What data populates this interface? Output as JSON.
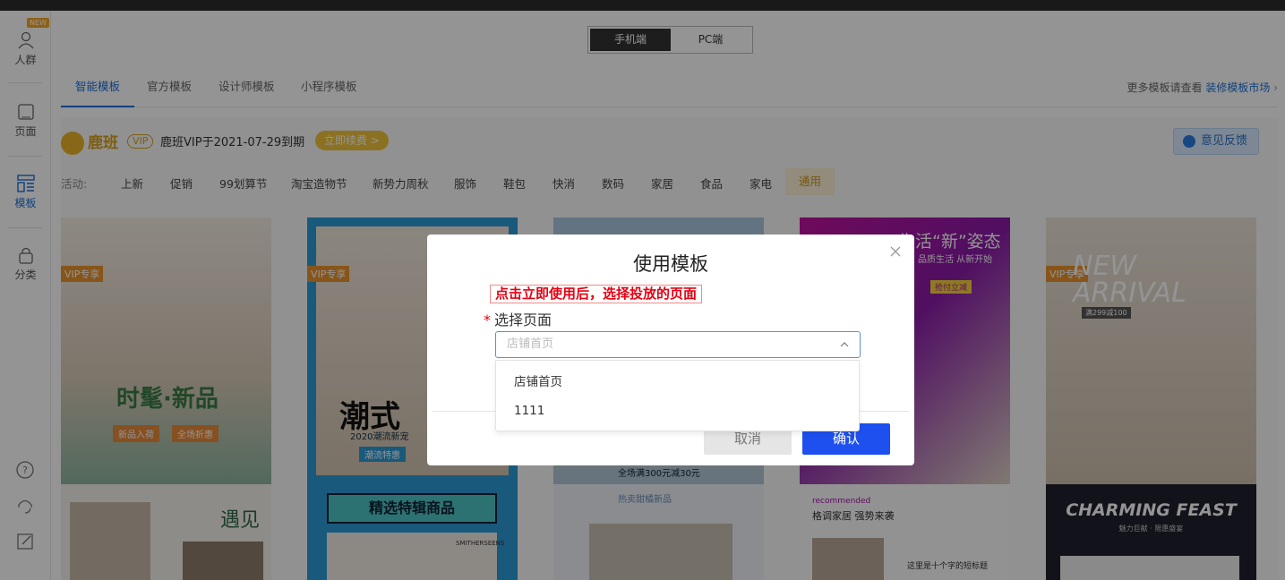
{
  "sidebar": {
    "new_badge": "NEW",
    "items": [
      {
        "label": "人群",
        "icon": "person-icon"
      },
      {
        "label": "页面",
        "icon": "page-icon"
      },
      {
        "label": "模板",
        "icon": "template-icon"
      },
      {
        "label": "分类",
        "icon": "lock-icon"
      }
    ],
    "bottom_icons": [
      "help-icon",
      "headset-icon",
      "edit-icon"
    ],
    "active_color": "#1e6fd9"
  },
  "device_toggle": {
    "options": [
      "手机端",
      "PC端"
    ],
    "selected": "手机端"
  },
  "tabs": {
    "items": [
      "智能模板",
      "官方模板",
      "设计师模板",
      "小程序模板"
    ],
    "active": "智能模板",
    "more_prefix": "更多模板请查看",
    "more_link": "装修模板市场"
  },
  "vip_bar": {
    "brand": "鹿班",
    "vip_tag": "VIP",
    "vip_text": "鹿班VIP于2021-07-29到期",
    "renew": "立即续费 >",
    "feedback": "意见反馈"
  },
  "categories": {
    "label": "活动:",
    "items": [
      "上新",
      "促销",
      "99划算节",
      "淘宝造物节",
      "新势力周秋",
      "服饰",
      "鞋包",
      "快消",
      "数码",
      "家居",
      "食品",
      "家电",
      "通用"
    ],
    "selected": "通用"
  },
  "cards": {
    "vip_label": "VIP专享",
    "row1": [
      {
        "texts": [
          "时髦·新品",
          "新品入荷",
          "全场折惠"
        ],
        "vip": true
      },
      {
        "texts": [
          "潮式",
          "2020潮流新宠",
          "潮流特惠"
        ],
        "vip": true
      },
      {
        "texts": [
          "全场满300元减30元"
        ],
        "vip": false
      },
      {
        "texts": [
          "生活“新”姿态",
          "品质生活 从新开始",
          "抢付立减"
        ],
        "vip": false
      },
      {
        "texts": [
          "NEW ARRIVAL",
          "满299减100"
        ],
        "vip": true
      }
    ],
    "row2": [
      {
        "texts": [
          "遇见"
        ]
      },
      {
        "texts": [
          "精选特辑商品",
          "SMITHERSEENS"
        ]
      },
      {
        "texts": [
          "热卖甜橘新品"
        ]
      },
      {
        "texts": [
          "recommended",
          "格调家居 强势来袭",
          "这里是十个字的短标题"
        ]
      },
      {
        "texts": [
          "CHARMING FEAST",
          "魅力巨献 · 限惠盛宴"
        ]
      }
    ]
  },
  "modal": {
    "title": "使用模板",
    "hint": "点击立即使用后，选择投放的页面",
    "field_label": "选择页面",
    "required_mark": "*",
    "select_placeholder": "店铺首页",
    "options": [
      "店铺首页",
      "1111"
    ],
    "cancel": "取消",
    "confirm": "确认",
    "confirm_color": "#1e50f0"
  }
}
